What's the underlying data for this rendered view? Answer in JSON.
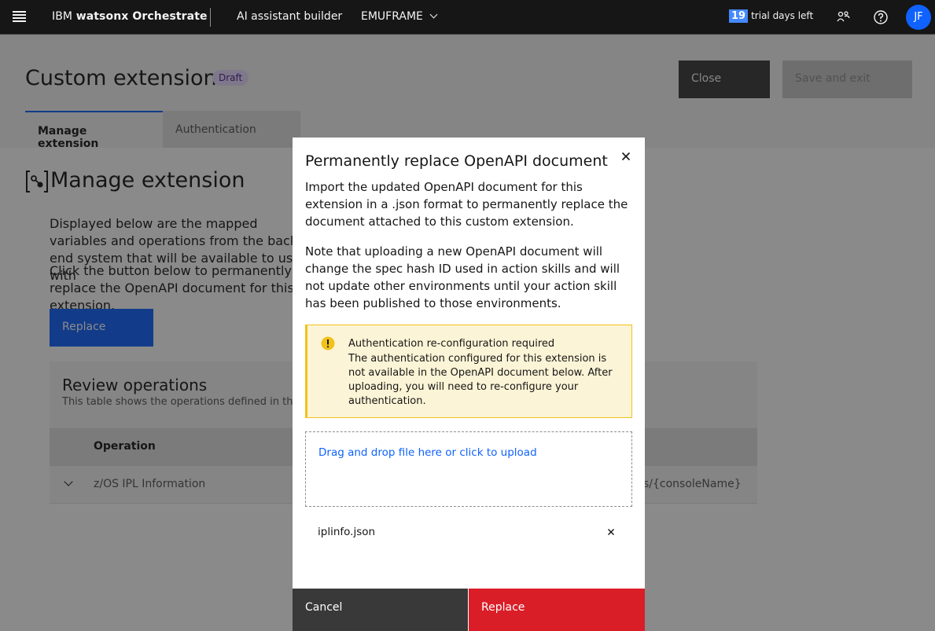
{
  "header": {
    "brand_prefix": "IBM",
    "brand_product": "watsonx Orchestrate",
    "nav_builder": "AI assistant builder",
    "instance": "EMUFRAME",
    "trial_days": "19",
    "trial_label": "trial days left",
    "avatar_initials": "JF"
  },
  "page": {
    "title": "Custom extension",
    "tag": "Draft",
    "close_label": "Close",
    "save_label": "Save and exit"
  },
  "tabs": [
    {
      "label": "Manage extension"
    },
    {
      "label": "Authentication"
    }
  ],
  "main": {
    "section_title": "Manage extension",
    "desc1": "Displayed below are the mapped variables and operations from the back end system that will be available to use with",
    "desc2": "Click the button below to permanently replace the OpenAPI document for this extension.",
    "replace_label": "Replace",
    "review_title": "Review operations",
    "review_desc": "This table shows the operations defined in the",
    "column_operation": "Operation",
    "row_operation": "z/OS IPL Information",
    "row_path": "s/{consoleName}"
  },
  "modal": {
    "title": "Permanently replace OpenAPI document",
    "p1": "Import the updated OpenAPI document for this extension in a .json format to permanently replace the document attached to this custom extension.",
    "p2": "Note that uploading a new OpenAPI document will change the spec hash ID used in action skills and will not update other environments until your action skill has been published to those environments.",
    "warning_title": "Authentication re-configuration required",
    "warning_body": "The authentication configured for this extension is not available in the OpenAPI document below. After uploading, you will need to re-configure your authentication.",
    "dropzone_text": "Drag and drop file here or click to upload",
    "file_name": "iplinfo.json",
    "cancel_label": "Cancel",
    "replace_label": "Replace"
  },
  "icons": {
    "menu": "hamburger-menu-icon",
    "users": "users-icon",
    "help": "help-icon",
    "extension": "extension-icon",
    "close": "close-icon",
    "warning": "warning-icon",
    "remove_file": "remove-file-icon",
    "expand": "chevron-down-icon"
  },
  "colors": {
    "primary": "#0f62fe",
    "danger": "#da1e28",
    "warning": "#f1c21b",
    "header_bg": "#161616"
  }
}
